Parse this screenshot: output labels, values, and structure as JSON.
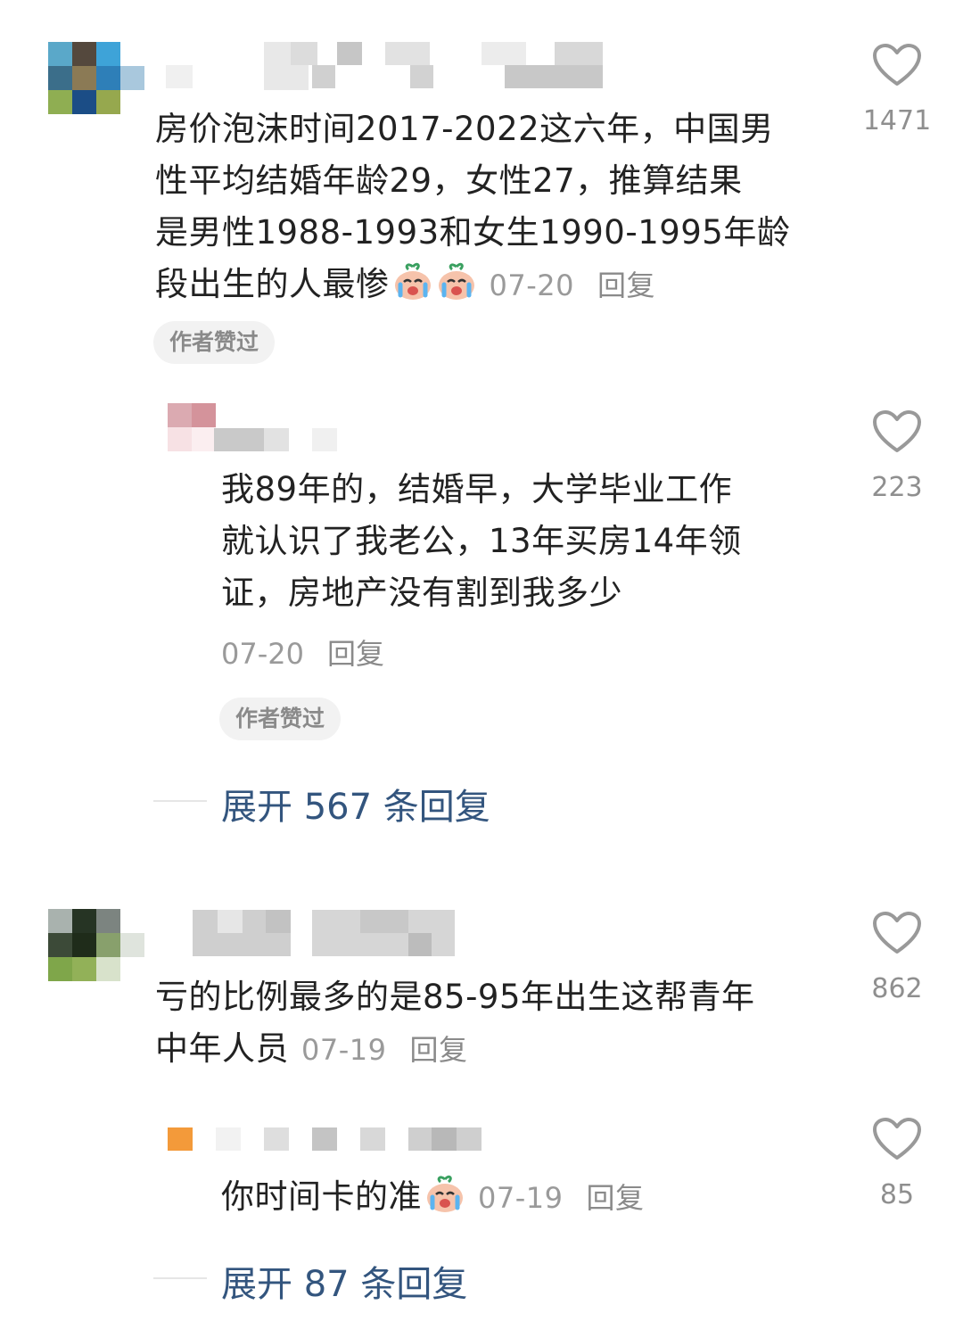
{
  "comments": [
    {
      "text_lines": [
        "房价泡沫时间2017-2022这六年，中国男",
        "性平均结婚年龄29，女性27，推算结果",
        "是男性1988-1993和女生1990-1995年龄",
        "段出生的人最惨"
      ],
      "emoji": [
        "crying-emoji",
        "crying-emoji"
      ],
      "date": "07-20",
      "reply_label": "回复",
      "badge": "作者赞过",
      "likes": "1471"
    },
    {
      "text_lines": [
        "我89年的，结婚早，大学毕业工作",
        "就认识了我老公，13年买房14年领",
        "证，房地产没有割到我多少"
      ],
      "date": "07-20",
      "reply_label": "回复",
      "badge": "作者赞过",
      "likes": "223"
    },
    {
      "expand_label": "展开 567 条回复"
    },
    {
      "text_lines": [
        "亏的比例最多的是85-95年出生这帮青年",
        "中年人员"
      ],
      "date": "07-19",
      "reply_label": "回复",
      "likes": "862"
    },
    {
      "text_lines": [
        "你时间卡的准"
      ],
      "emoji": [
        "crying-emoji"
      ],
      "date": "07-19",
      "reply_label": "回复",
      "likes": "85"
    },
    {
      "expand_label": "展开 87 条回复"
    }
  ],
  "colors": {
    "text": "#222222",
    "meta": "#9a9a9a",
    "expand_link": "#33557e",
    "badge_bg": "#f2f2f2"
  },
  "icons": {
    "like": "heart-outline-icon"
  }
}
